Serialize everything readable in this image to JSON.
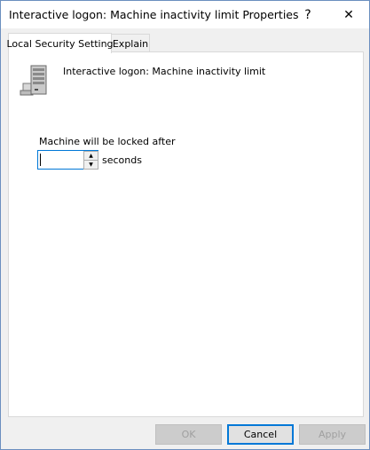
{
  "window": {
    "title": "Interactive logon: Machine inactivity limit Properties",
    "help_label": "?",
    "close_label": "✕"
  },
  "tabs": [
    {
      "label": "Local Security Setting",
      "active": true
    },
    {
      "label": "Explain",
      "active": false
    }
  ],
  "setting": {
    "policy_name": "Interactive logon: Machine inactivity limit",
    "policy_icon": "server-computer-icon",
    "lock_label": "Machine will be locked after",
    "value": "",
    "unit_label": "seconds",
    "spin_up_glyph": "▲",
    "spin_down_glyph": "▼"
  },
  "buttons": {
    "ok": "OK",
    "cancel": "Cancel",
    "apply": "Apply"
  },
  "colors": {
    "accent": "#0078d7",
    "window_bg": "#f0f0f0",
    "panel_bg": "#ffffff"
  }
}
